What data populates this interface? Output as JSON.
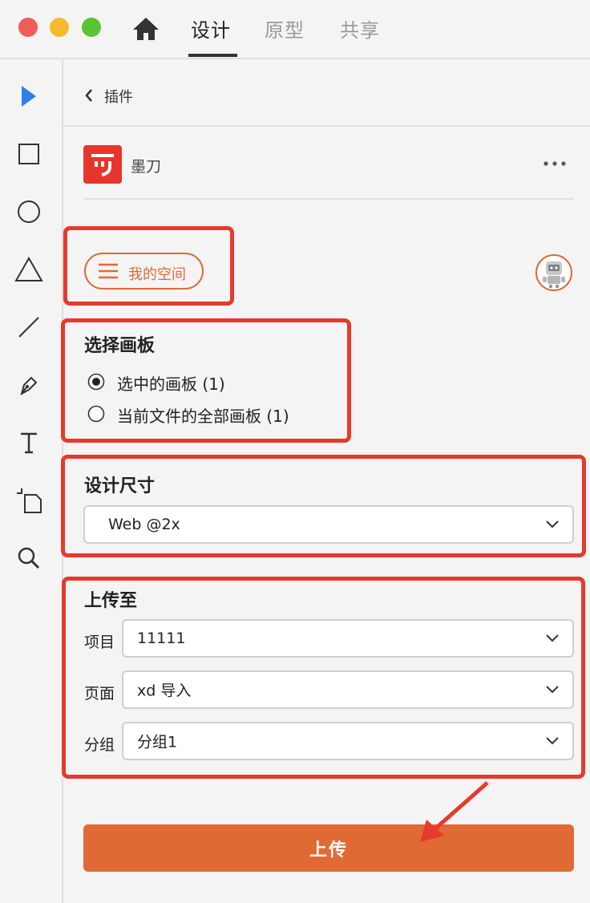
{
  "window": {
    "traffic_lights": [
      "#ee5e57",
      "#f4bb2f",
      "#5bc434"
    ],
    "tabs": [
      {
        "label": "设计",
        "active": true
      },
      {
        "label": "原型",
        "active": false
      },
      {
        "label": "共享",
        "active": false
      }
    ]
  },
  "toolbar": {
    "tools": [
      "select-arrow-icon",
      "rectangle-icon",
      "ellipse-icon",
      "triangle-icon",
      "line-icon",
      "pen-icon",
      "text-icon",
      "artboard-icon",
      "zoom-icon"
    ]
  },
  "panel": {
    "back_label": "插件",
    "plugin": {
      "name": "墨刀",
      "logo_text": "リ",
      "brand_color": "#e8352c"
    },
    "space_button_label": "我的空间",
    "artboard_section": {
      "title": "选择画板",
      "options": [
        {
          "label": "选中的画板 (1)",
          "checked": true
        },
        {
          "label": "当前文件的全部画板 (1)",
          "checked": false
        }
      ]
    },
    "size_section": {
      "title": "设计尺寸",
      "value": "Web @2x"
    },
    "upload_section": {
      "title": "上传至",
      "fields": [
        {
          "label": "项目",
          "value": "11111"
        },
        {
          "label": "页面",
          "value": "xd 导入"
        },
        {
          "label": "分组",
          "value": "分组1"
        }
      ]
    },
    "upload_button_label": "上传",
    "accent_color": "#e06a33"
  }
}
